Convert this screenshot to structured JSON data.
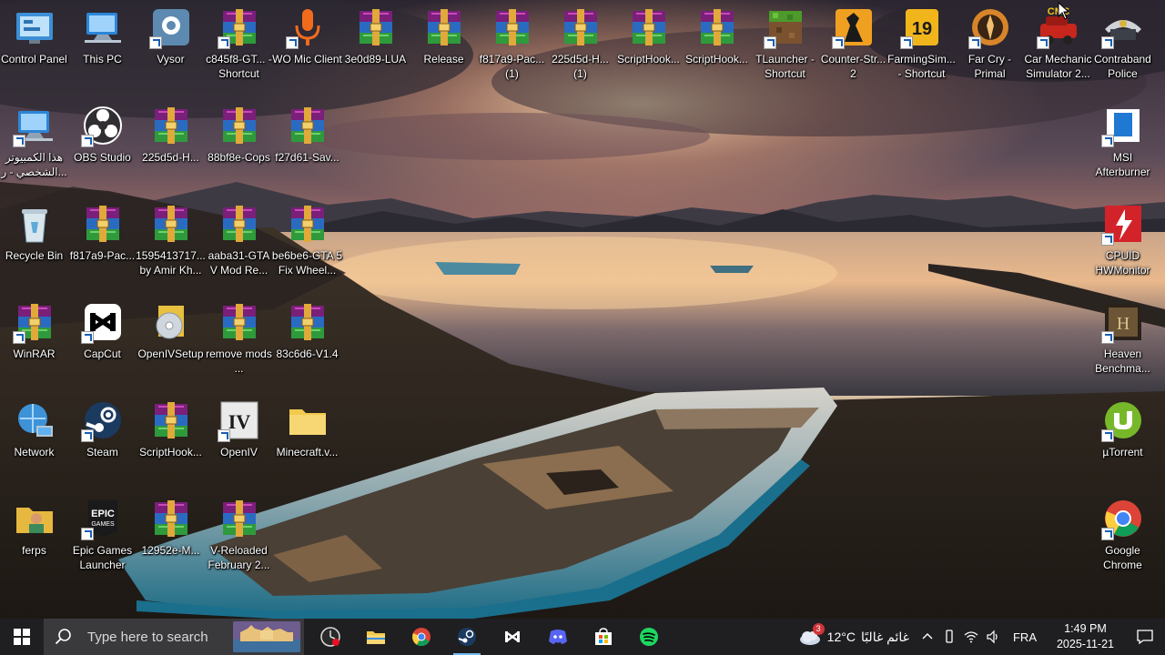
{
  "desktop": {
    "icons": [
      {
        "label": "Control Panel",
        "type": "control-panel",
        "shortcut": false
      },
      {
        "label": "This PC",
        "type": "this-pc",
        "shortcut": false
      },
      {
        "label": "Vysor",
        "type": "vysor",
        "shortcut": true
      },
      {
        "label": "c845f8-GT... - Shortcut",
        "type": "winrar-archive",
        "shortcut": true
      },
      {
        "label": "WO Mic Client",
        "type": "wo-mic",
        "shortcut": true
      },
      {
        "label": "3e0d89-LUA",
        "type": "winrar-archive",
        "shortcut": false
      },
      {
        "label": "Release",
        "type": "winrar-archive",
        "shortcut": false
      },
      {
        "label": "f817a9-Pac... (1)",
        "type": "winrar-archive",
        "shortcut": false
      },
      {
        "label": "225d5d-H... (1)",
        "type": "winrar-archive",
        "shortcut": false
      },
      {
        "label": "ScriptHook...",
        "type": "winrar-archive",
        "shortcut": false
      },
      {
        "label": "ScriptHook...",
        "type": "winrar-archive",
        "shortcut": false
      },
      {
        "label": "TLauncher - Shortcut",
        "type": "tlauncher",
        "shortcut": true
      },
      {
        "label": "Counter-Str... 2",
        "type": "counter-strike",
        "shortcut": true
      },
      {
        "label": "FarmingSim... - Shortcut",
        "type": "farming-sim",
        "shortcut": true
      },
      {
        "label": "Far Cry - Primal",
        "type": "far-cry",
        "shortcut": true
      },
      {
        "label": "Car Mechanic Simulator 2...",
        "type": "car-mechanic",
        "shortcut": true
      },
      {
        "label": "Contraband Police",
        "type": "contraband",
        "shortcut": true
      },
      {
        "label": "هذا الكمبيوتر الشخصي - ر...",
        "type": "this-pc",
        "shortcut": true
      },
      {
        "label": "OBS Studio",
        "type": "obs",
        "shortcut": true
      },
      {
        "label": "225d5d-H...",
        "type": "winrar-archive",
        "shortcut": false
      },
      {
        "label": "88bf8e-Cops",
        "type": "winrar-archive",
        "shortcut": false
      },
      {
        "label": "f27d61-Sav...",
        "type": "winrar-archive",
        "shortcut": false
      },
      {
        "label": "MSI Afterburner",
        "type": "msi-afterburner",
        "shortcut": true
      },
      {
        "label": "Recycle Bin",
        "type": "recycle-bin",
        "shortcut": false
      },
      {
        "label": "f817a9-Pac...",
        "type": "winrar-archive",
        "shortcut": false
      },
      {
        "label": "1595413717... by Amir Kh...",
        "type": "winrar-archive",
        "shortcut": false
      },
      {
        "label": "aaba31-GTA V Mod Re...",
        "type": "winrar-archive",
        "shortcut": false
      },
      {
        "label": "be6be6-GTA 5 Fix Wheel...",
        "type": "winrar-archive",
        "shortcut": false
      },
      {
        "label": "CPUID HWMonitor",
        "type": "hwmonitor",
        "shortcut": true
      },
      {
        "label": "WinRAR",
        "type": "winrar-archive",
        "shortcut": true
      },
      {
        "label": "CapCut",
        "type": "capcut",
        "shortcut": true
      },
      {
        "label": "OpenIVSetup",
        "type": "setup-disc",
        "shortcut": false
      },
      {
        "label": "remove mods ...",
        "type": "winrar-archive",
        "shortcut": false
      },
      {
        "label": "83c6d6-V1.4",
        "type": "winrar-archive",
        "shortcut": false
      },
      {
        "label": "Heaven Benchma...",
        "type": "heaven",
        "shortcut": true
      },
      {
        "label": "Network",
        "type": "network",
        "shortcut": false
      },
      {
        "label": "Steam",
        "type": "steam",
        "shortcut": true
      },
      {
        "label": "ScriptHook...",
        "type": "winrar-archive",
        "shortcut": false
      },
      {
        "label": "OpenIV",
        "type": "openiv",
        "shortcut": true
      },
      {
        "label": "Minecraft.v...",
        "type": "folder",
        "shortcut": false
      },
      {
        "label": "µTorrent",
        "type": "utorrent",
        "shortcut": true
      },
      {
        "label": "ferps",
        "type": "user-folder",
        "shortcut": false
      },
      {
        "label": "Epic Games Launcher",
        "type": "epic",
        "shortcut": true
      },
      {
        "label": "12952e-M...",
        "type": "winrar-archive",
        "shortcut": false
      },
      {
        "label": "V-Reloaded February 2...",
        "type": "winrar-archive",
        "shortcut": false
      },
      {
        "label": "Google Chrome",
        "type": "chrome",
        "shortcut": true
      }
    ]
  },
  "taskbar": {
    "search_placeholder": "Type here to search",
    "pinned_apps": [
      {
        "name": "browser-pinned-icon",
        "active": false
      },
      {
        "name": "file-explorer-icon",
        "active": false
      },
      {
        "name": "chrome-icon",
        "active": false
      },
      {
        "name": "steam-icon",
        "active": true
      },
      {
        "name": "capcut-icon",
        "active": false
      },
      {
        "name": "discord-icon",
        "active": false
      },
      {
        "name": "microsoft-store-icon",
        "active": false
      },
      {
        "name": "spotify-icon",
        "active": false
      }
    ],
    "weather": {
      "temp": "12°C",
      "condition": "غائم غالبًا",
      "badge": "3"
    },
    "language": "FRA",
    "time": "1:49 PM",
    "date": "2025-11-21"
  },
  "colors": {
    "taskbar_bg": "#1f1f22",
    "search_bg": "#3a3a3d",
    "accent": "#76b9ed"
  }
}
